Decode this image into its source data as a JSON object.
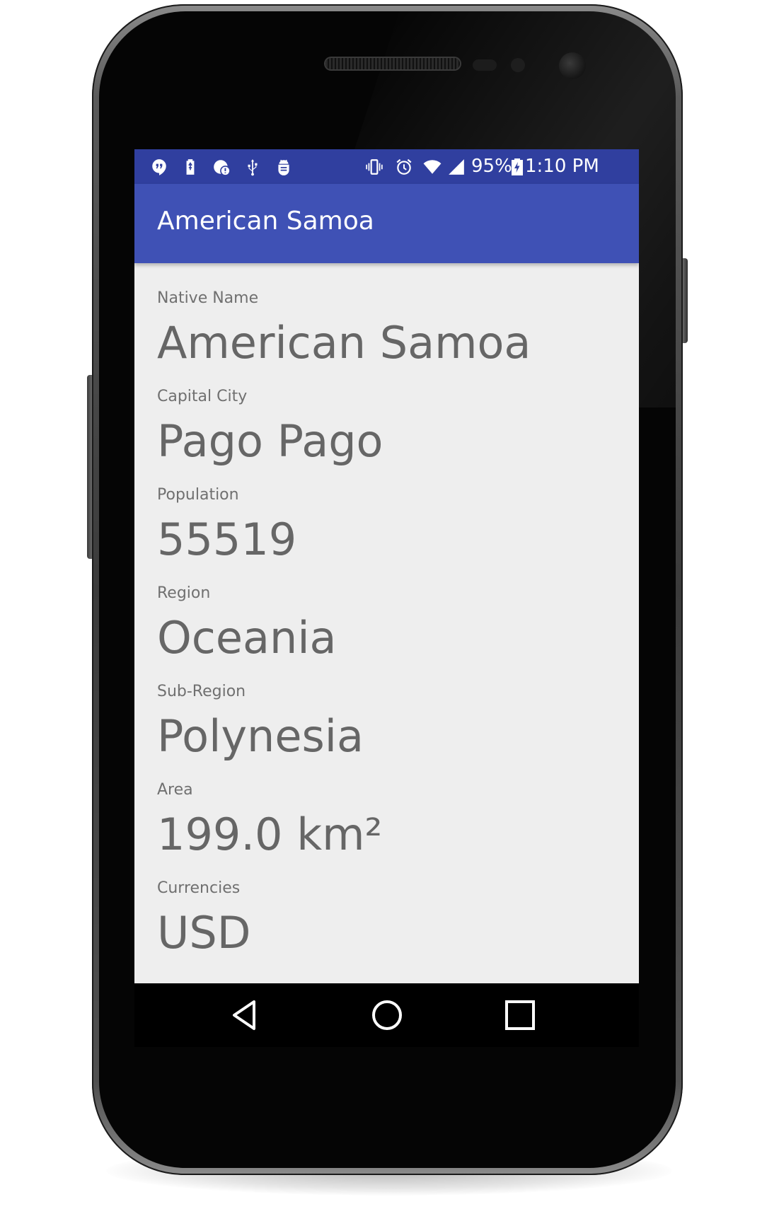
{
  "status_bar": {
    "battery_percent": "95%",
    "time": "1:10 PM",
    "left_icons": [
      "hangouts-icon",
      "battery-usb-icon",
      "sync-alert-icon",
      "usb-icon",
      "android-debug-icon"
    ],
    "right_icons": [
      "vibrate-icon",
      "alarm-icon",
      "wifi-icon",
      "cell-signal-icon",
      "battery-charging-icon"
    ]
  },
  "app_bar": {
    "title": "American Samoa"
  },
  "details": [
    {
      "label": "Native Name",
      "value": "American Samoa"
    },
    {
      "label": "Capital City",
      "value": "Pago Pago"
    },
    {
      "label": "Population",
      "value": "55519"
    },
    {
      "label": "Region",
      "value": "Oceania"
    },
    {
      "label": "Sub-Region",
      "value": "Polynesia"
    },
    {
      "label": "Area",
      "value": "199.0 km²"
    },
    {
      "label": "Currencies",
      "value": "USD"
    }
  ],
  "nav_bar": {
    "buttons": [
      "back-icon",
      "home-icon",
      "recents-icon"
    ]
  },
  "colors": {
    "status_bar": "#303f9f",
    "app_bar": "#3f51b5",
    "content_bg": "#eeeeee",
    "label_text": "#707070",
    "value_text": "#666666"
  }
}
